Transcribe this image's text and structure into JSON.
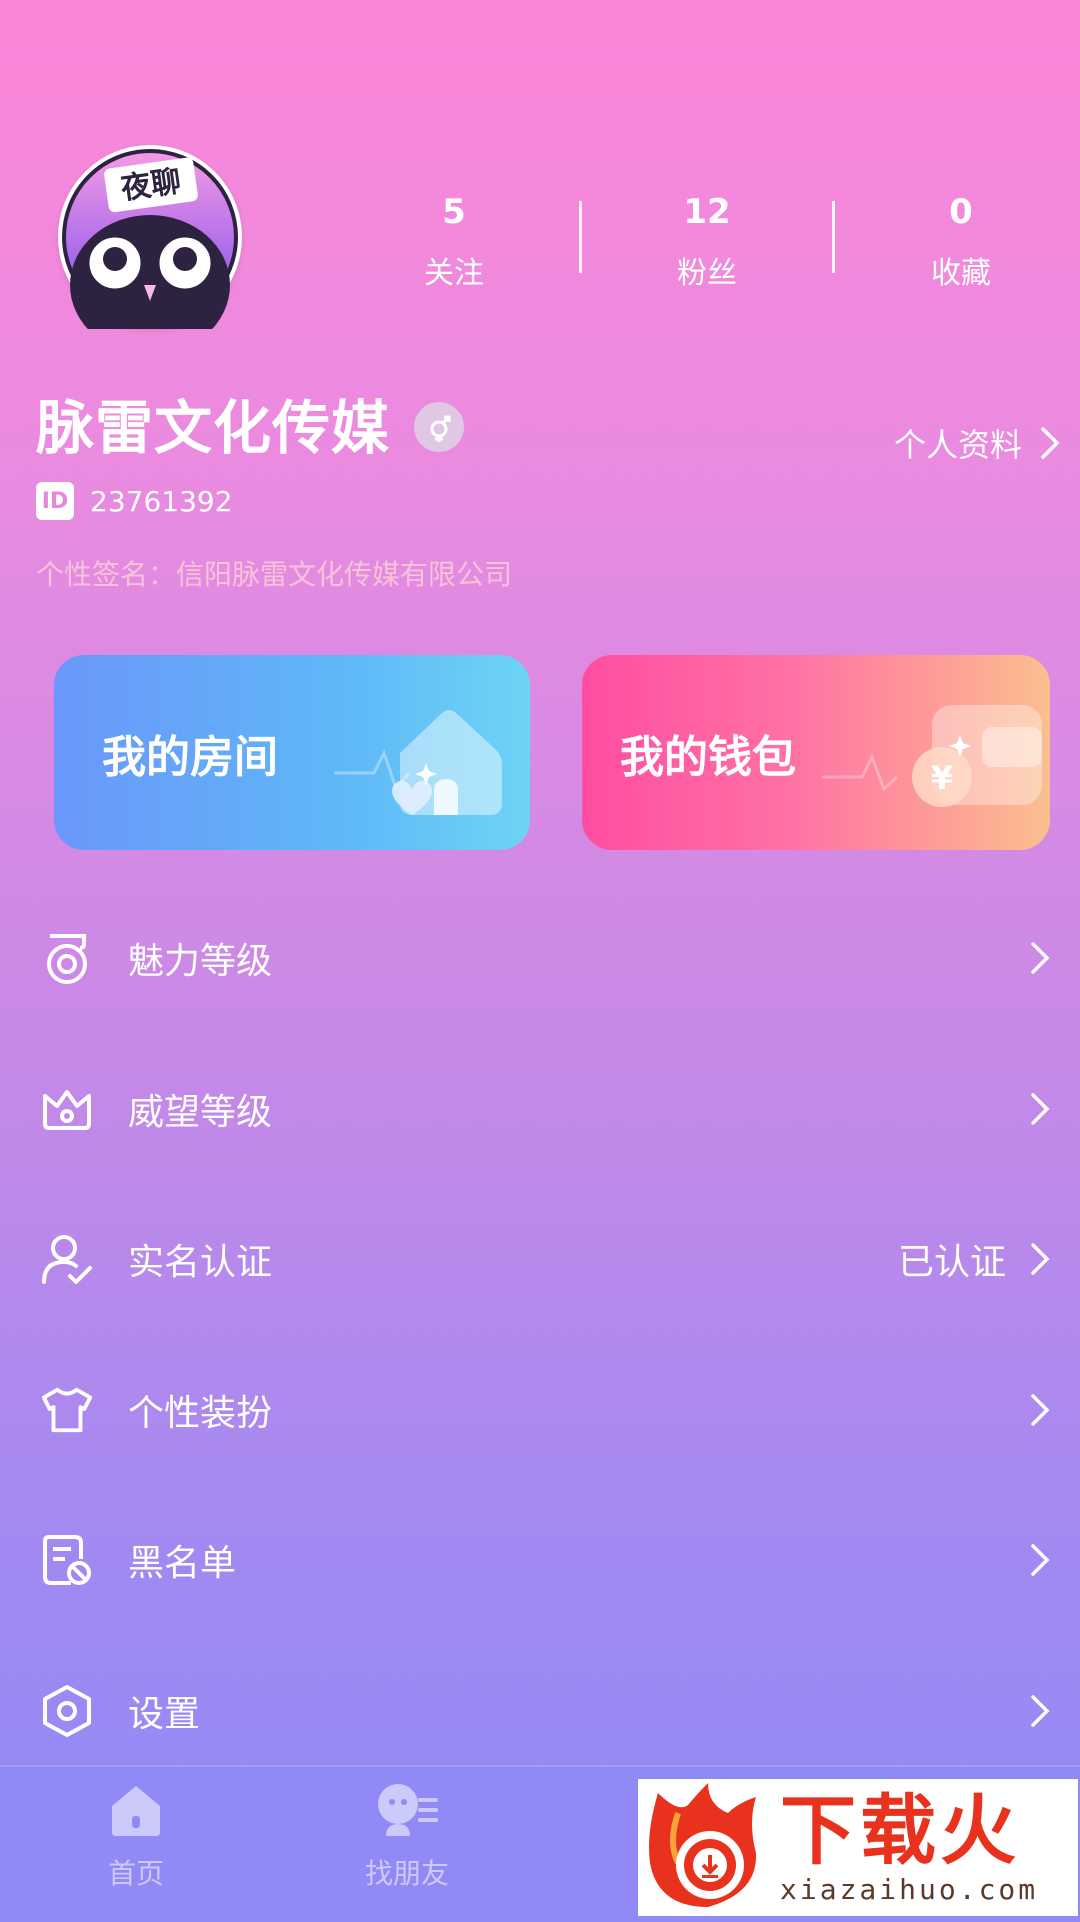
{
  "profile": {
    "avatar_text": "夜聊",
    "username": "脉雷文化传媒",
    "id_label": "ID",
    "id_value": "23761392",
    "signature": "个性签名：信阳脉雷文化传媒有限公司",
    "profile_link": "个人资料"
  },
  "stats": [
    {
      "value": "5",
      "label": "关注"
    },
    {
      "value": "12",
      "label": "粉丝"
    },
    {
      "value": "0",
      "label": "收藏"
    }
  ],
  "cards": {
    "room": "我的房间",
    "wallet": "我的钱包"
  },
  "menu": [
    {
      "label": "魅力等级",
      "value": "",
      "icon": "charm-level-icon"
    },
    {
      "label": "威望等级",
      "value": "",
      "icon": "crown-icon"
    },
    {
      "label": "实名认证",
      "value": "已认证",
      "icon": "user-verified-icon"
    },
    {
      "label": "个性装扮",
      "value": "",
      "icon": "tshirt-icon"
    },
    {
      "label": "黑名单",
      "value": "",
      "icon": "blacklist-icon"
    },
    {
      "label": "设置",
      "value": "",
      "icon": "settings-icon"
    }
  ],
  "nav": [
    {
      "label": "首页",
      "icon": "home-icon"
    },
    {
      "label": "找朋友",
      "icon": "find-friends-icon"
    }
  ],
  "watermark": {
    "title": "下载火",
    "url": "xiazaihuo.com"
  },
  "colors": {
    "bg_top": "#fb86d9",
    "bg_bottom": "#8f8af6",
    "room_card": "#6a97fb",
    "wallet_card": "#ff4da2",
    "watermark_red": "#e8321e"
  }
}
